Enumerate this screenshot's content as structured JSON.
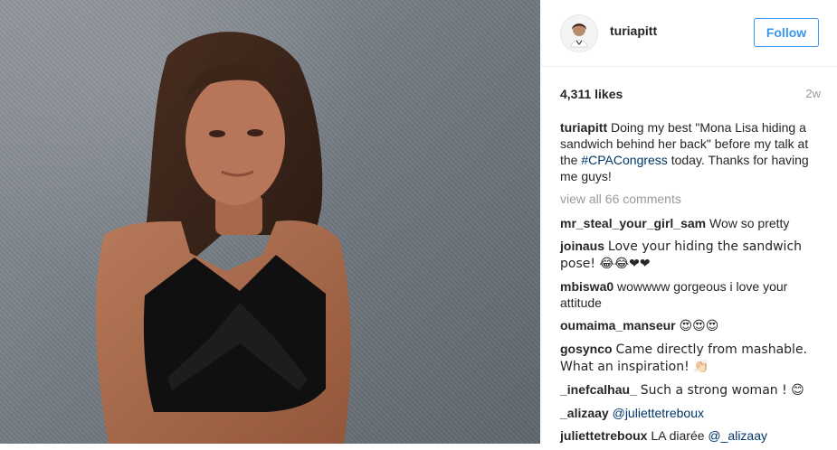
{
  "post": {
    "username": "turiapitt",
    "follow_label": "Follow",
    "likes": "4,311 likes",
    "time_ago": "2w",
    "caption_user": "turiapitt",
    "caption_text_1": "Doing my best \"Mona Lisa hiding a sandwich behind her back\" before my talk at the ",
    "caption_hashtag": "#CPACongress",
    "caption_text_2": " today. Thanks for having me guys!",
    "view_all": "view all 66 comments",
    "comments": [
      {
        "user": "mr_steal_your_girl_sam",
        "text": "Wow so pretty"
      },
      {
        "user": "joinaus",
        "text": "Love your hiding the sandwich pose! 😂😂❤❤"
      },
      {
        "user": "mbiswa0",
        "text": "wowwww gorgeous i love your attitude"
      },
      {
        "user": "oumaima_manseur",
        "text": "😍😍😍"
      },
      {
        "user": "gosynco",
        "text": "Came directly from mashable. What an inspiration! 👏🏻"
      },
      {
        "user": "_inefcalhau_",
        "text": "Such a strong woman ! 😊"
      },
      {
        "user": "_alizaay",
        "mention": "@juliettetreboux"
      },
      {
        "user": "juliettetreboux",
        "text": "LA diarée ",
        "mention": "@_alizaay"
      }
    ]
  },
  "colors": {
    "accent": "#3897f0",
    "link": "#003569",
    "muted": "#999999",
    "text": "#262626"
  },
  "icons": {
    "avatar": "profile-photo"
  }
}
